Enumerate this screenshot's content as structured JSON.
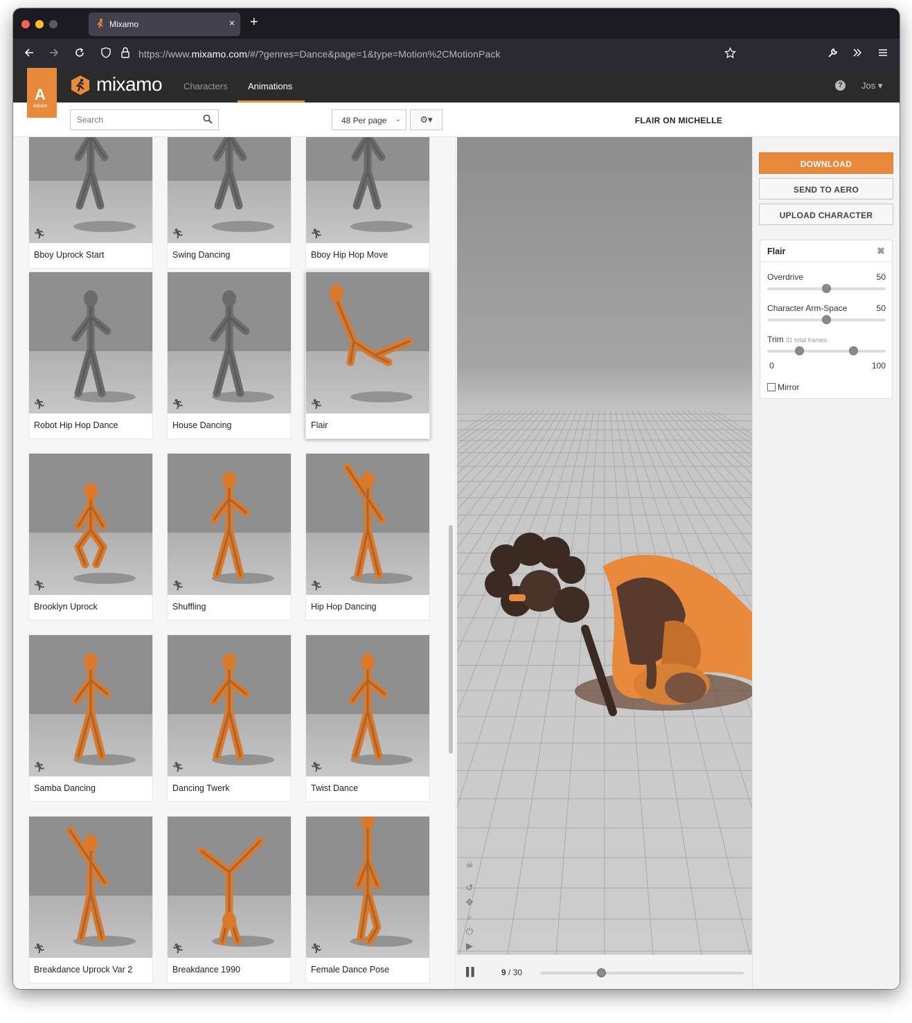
{
  "browser": {
    "tab_title": "Mixamo",
    "tab_close": "×",
    "new_tab": "+",
    "url_prefix": "https://www.",
    "url_host": "mixamo.com",
    "url_rest": "/#/?genres=Dance&page=1&type=Motion%2CMotionPack",
    "traffic_colors": [
      "#ff5f57",
      "#febc2e",
      "#5c5c5c"
    ]
  },
  "header": {
    "adobe_letter": "A",
    "adobe_word": "Adobe",
    "logo_text": "mixamo",
    "nav": [
      "Characters",
      "Animations"
    ],
    "active_nav": "Animations",
    "help": "?",
    "user": "Jos ▾",
    "accent": "#e8893b"
  },
  "toolbar": {
    "search_placeholder": "Search",
    "per_page": "48 Per page",
    "per_page_caret": "⌄",
    "settings": "⚙▾"
  },
  "animations": [
    {
      "label": "Bboy Uprock Start",
      "skin": "gray",
      "pose": "walk"
    },
    {
      "label": "Swing Dancing",
      "skin": "gray",
      "pose": "walk"
    },
    {
      "label": "Bboy Hip Hop Move",
      "skin": "gray",
      "pose": "walk"
    },
    {
      "label": "Robot Hip Hop Dance",
      "skin": "gray",
      "pose": "stand"
    },
    {
      "label": "House Dancing",
      "skin": "gray",
      "pose": "stand"
    },
    {
      "label": "Flair",
      "skin": "orange",
      "pose": "flair",
      "selected": true
    },
    {
      "label": "Brooklyn Uprock",
      "skin": "orange",
      "pose": "crouch"
    },
    {
      "label": "Shuffling",
      "skin": "orange",
      "pose": "stand"
    },
    {
      "label": "Hip Hop Dancing",
      "skin": "orange",
      "pose": "wave"
    },
    {
      "label": "Samba Dancing",
      "skin": "orange",
      "pose": "stand"
    },
    {
      "label": "Dancing Twerk",
      "skin": "orange",
      "pose": "stand"
    },
    {
      "label": "Twist Dance",
      "skin": "orange",
      "pose": "stand"
    },
    {
      "label": "Breakdance Uprock Var 2",
      "skin": "orange",
      "pose": "wave"
    },
    {
      "label": "Breakdance 1990",
      "skin": "orange",
      "pose": "handstand"
    },
    {
      "label": "Female Dance Pose",
      "skin": "orange",
      "pose": "tall"
    }
  ],
  "viewer": {
    "title": "FLAIR ON MICHELLE",
    "frame_current": "9",
    "frame_total": "/ 30",
    "progress": 0.3,
    "tool_icons": [
      "☠",
      "↺",
      "✥",
      "⌕",
      "⏻",
      "▶"
    ]
  },
  "actions": {
    "download": "DOWNLOAD",
    "send_to_aero": "SEND TO AERO",
    "upload_character": "UPLOAD CHARACTER"
  },
  "params": {
    "title": "Flair",
    "close": "✖",
    "overdrive_label": "Overdrive",
    "overdrive_value": "50",
    "overdrive_fraction": 0.5,
    "armspace_label": "Character Arm-Space",
    "armspace_value": "50",
    "armspace_fraction": 0.5,
    "trim_label": "Trim",
    "trim_sub": "31 total frames",
    "trim_start": "0",
    "trim_end": "100",
    "trim_start_fraction": 0.27,
    "trim_end_fraction": 0.73,
    "mirror_label": "Mirror"
  }
}
